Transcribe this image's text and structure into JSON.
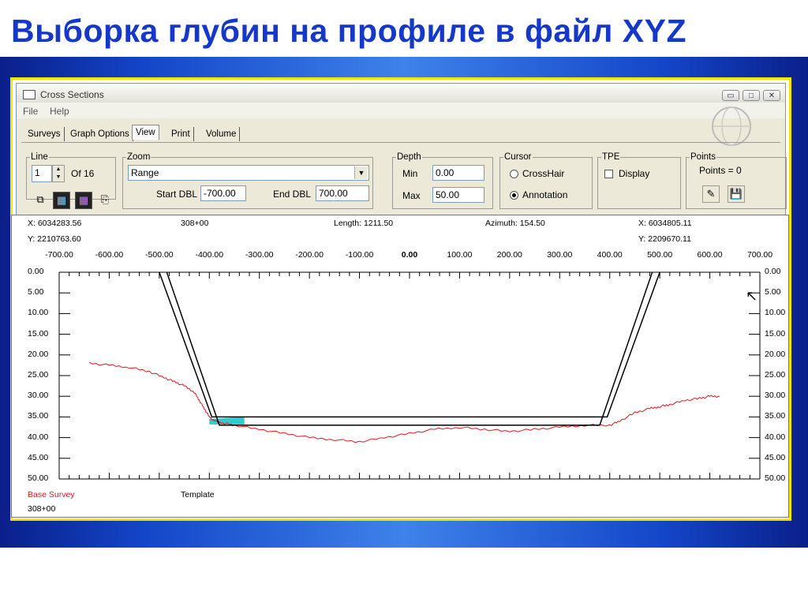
{
  "slide": {
    "title": "Выборка глубин на профиле в файл XYZ"
  },
  "window": {
    "title": "Cross  Sections",
    "controls": {
      "minimize": "▭",
      "maximize": "□",
      "close": "✕"
    }
  },
  "menu": [
    "File",
    "Help"
  ],
  "tabs": [
    "Surveys",
    "Graph Options",
    "View",
    "Print",
    "Volume"
  ],
  "active_tab": "View",
  "line": {
    "legend": "Line",
    "value": "1",
    "of_label": "Of 16"
  },
  "zoom": {
    "legend": "Zoom",
    "selected": "Range",
    "start_label": "Start DBL",
    "start_value": "-700.00",
    "end_label": "End DBL",
    "end_value": "700.00"
  },
  "depth": {
    "legend": "Depth",
    "min_label": "Min",
    "min_value": "0.00",
    "max_label": "Max",
    "max_value": "50.00"
  },
  "cursor": {
    "legend": "Cursor",
    "options": [
      {
        "label": "CrossHair",
        "selected": false
      },
      {
        "label": "Annotation",
        "selected": true
      }
    ]
  },
  "tpe": {
    "legend": "TPE",
    "display_label": "Display",
    "checked": false
  },
  "points": {
    "legend": "Points",
    "count_label": "Points = 0"
  },
  "graph": {
    "x_left": "X: 6034283.56",
    "y_left": "Y: 2210763.60",
    "station": "308+00",
    "length": "Length: 1211.50",
    "azimuth": "Azimuth: 154.50",
    "x_right": "X: 6034805.11",
    "y_right": "Y: 2209670.11",
    "legend_base": "Base Survey",
    "legend_template": "Template",
    "footer_station": "308+00",
    "colors": {
      "base": "#e8141e",
      "template": "#000000",
      "fill": "#33cccc"
    }
  },
  "chart_data": {
    "type": "line",
    "xlim": [
      -700,
      700
    ],
    "ylim": [
      0,
      50
    ],
    "y_inverted": true,
    "x_ticks": [
      "-700.00",
      "-600.00",
      "-500.00",
      "-400.00",
      "-300.00",
      "-200.00",
      "-100.00",
      "0.00",
      "100.00",
      "200.00",
      "300.00",
      "400.00",
      "500.00",
      "600.00",
      "700.00"
    ],
    "y_ticks": [
      "0.00",
      "5.00",
      "10.00",
      "15.00",
      "20.00",
      "25.00",
      "30.00",
      "35.00",
      "40.00",
      "45.00",
      "50.00"
    ],
    "series": [
      {
        "name": "Base Survey",
        "x": [
          -640,
          -600,
          -560,
          -520,
          -490,
          -470,
          -450,
          -430,
          -420,
          -410,
          -400,
          -390,
          -370,
          -350,
          -300,
          -250,
          -200,
          -150,
          -100,
          -50,
          0,
          50,
          100,
          150,
          200,
          250,
          300,
          350,
          400,
          420,
          450,
          480,
          500,
          520,
          550,
          580,
          600,
          620
        ],
        "y": [
          22,
          22.5,
          23,
          24,
          25.5,
          26.5,
          27.5,
          29,
          31,
          33,
          35,
          36,
          36.5,
          37,
          38,
          39,
          40,
          40.5,
          41,
          40,
          39,
          38,
          37.5,
          38,
          38.5,
          38,
          37.5,
          37,
          37,
          36,
          34,
          33,
          32.5,
          32,
          31,
          30.5,
          30,
          30
        ]
      },
      {
        "name": "Template",
        "x": [
          -500,
          -395,
          395,
          500
        ],
        "y": [
          0,
          35,
          35,
          0
        ]
      }
    ]
  }
}
